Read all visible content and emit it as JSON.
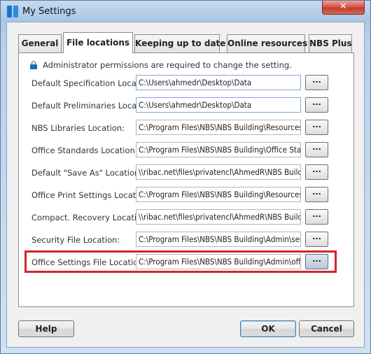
{
  "window": {
    "title": "My Settings",
    "close_symbol": "✕"
  },
  "tabs": [
    {
      "label": "General",
      "active": false
    },
    {
      "label": "File locations",
      "active": true
    },
    {
      "label": "Keeping up to date",
      "active": false
    },
    {
      "label": "Online resources",
      "active": false
    },
    {
      "label": "NBS Plus",
      "active": false
    }
  ],
  "notice": "Administrator permissions are required to change the setting.",
  "settings": [
    {
      "label": "Default Specification Location:",
      "value": "C:\\Users\\ahmedr\\Desktop\\Data",
      "editable": true
    },
    {
      "label": "Default Preliminaries Location:",
      "value": "C:\\Users\\ahmedr\\Desktop\\Data",
      "editable": true
    },
    {
      "label": "NBS Libraries Location:",
      "value": "C:\\Program Files\\NBS\\NBS Building\\Resources\\",
      "editable": false
    },
    {
      "label": "Office Standards Location:",
      "value": "C:\\Program Files\\NBS\\NBS Building\\Office Standa",
      "editable": false
    },
    {
      "label": "Default \"Save As\" Location:",
      "value": "\\\\ribac.net\\files\\privatencl\\AhmedR\\NBS Building",
      "editable": false
    },
    {
      "label": "Office Print Settings Location:",
      "value": "C:\\Program Files\\NBS\\NBS Building\\Resources\\o",
      "editable": false
    },
    {
      "label": "Compact. Recovery Location:",
      "value": "\\\\ribac.net\\files\\privatencl\\AhmedR\\NBS Building",
      "editable": false
    },
    {
      "label": "Security File Location:",
      "value": "C:\\Program Files\\NBS\\NBS Building\\Admin\\securi",
      "editable": false
    },
    {
      "label": "Office Settings File Location:",
      "value": "C:\\Program Files\\NBS\\NBS Building\\Admin\\offices",
      "editable": false
    }
  ],
  "browse_label": "...",
  "buttons": {
    "help": "Help",
    "ok": "OK",
    "cancel": "Cancel"
  }
}
